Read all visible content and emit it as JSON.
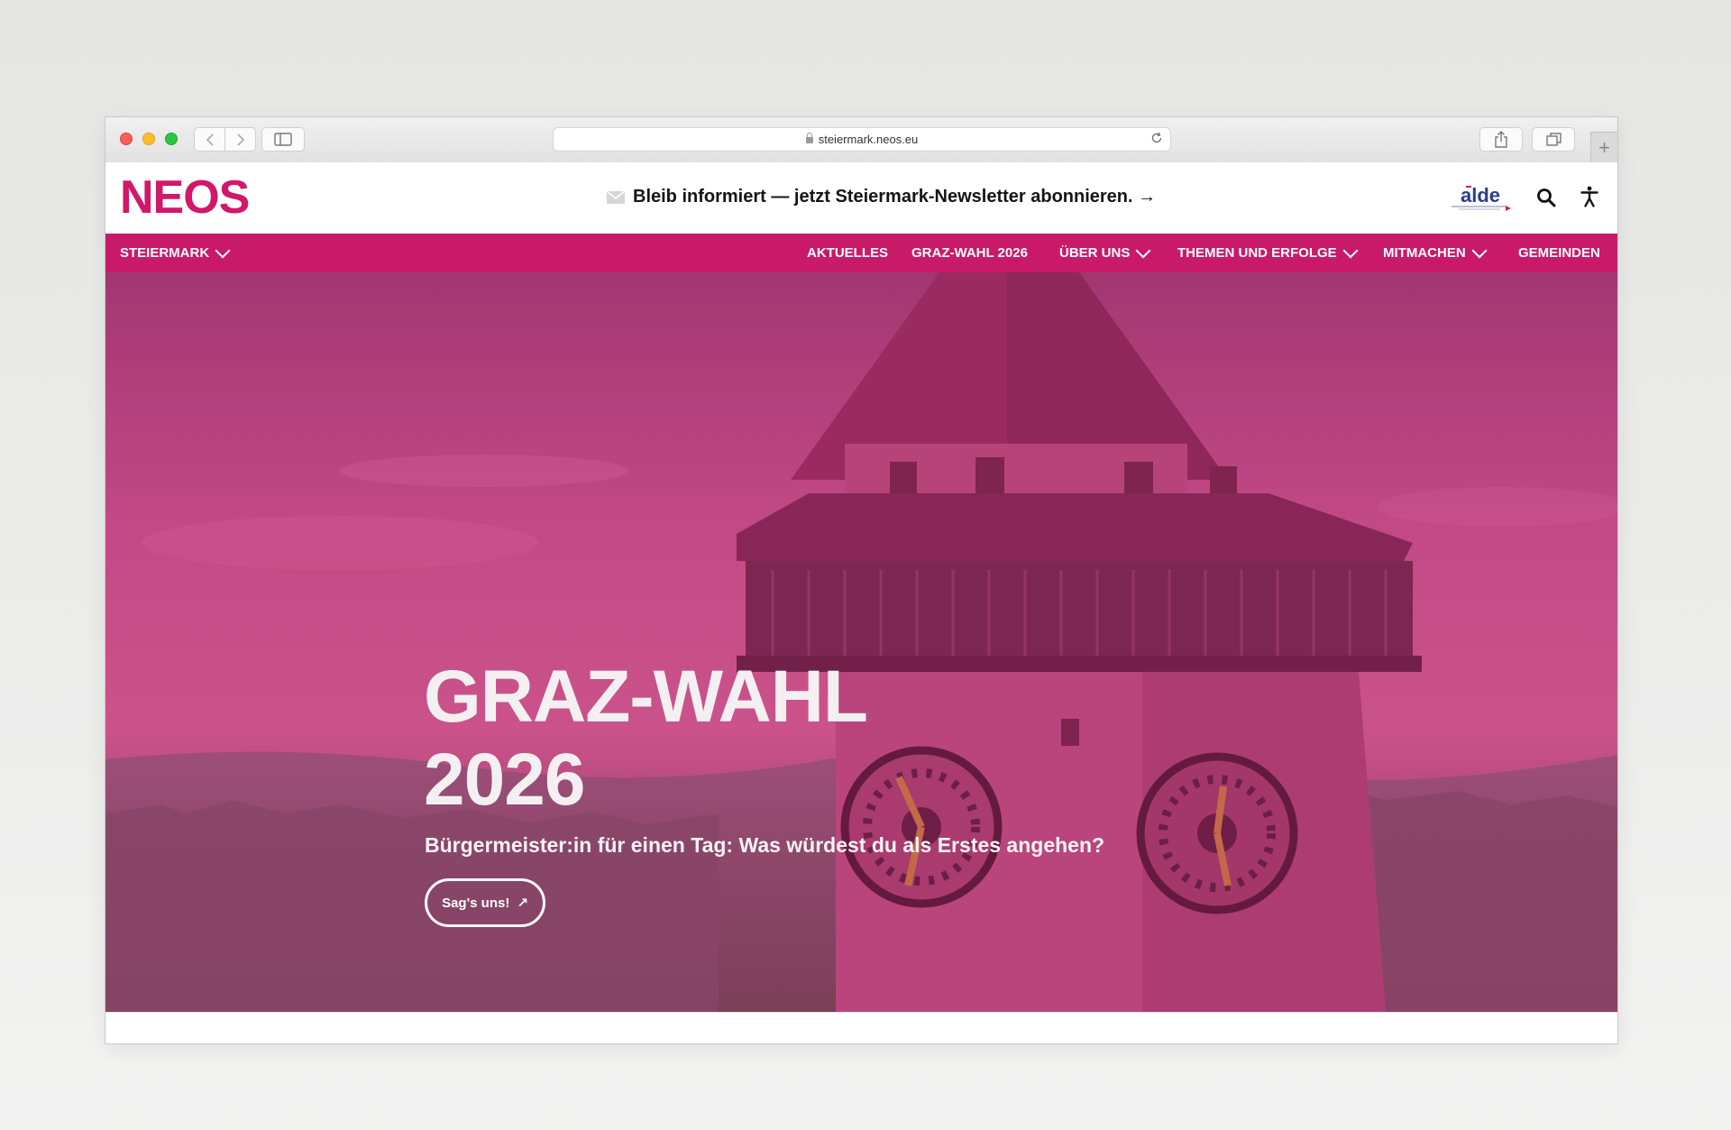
{
  "browser": {
    "url": "steiermark.neos.eu",
    "new_tab_label": "+"
  },
  "header": {
    "logo": "NEOS",
    "newsletter_text": "Bleib informiert — jetzt Steiermark-Newsletter abonnieren. →",
    "partner_logo": "alde"
  },
  "nav": {
    "region": "STEIERMARK",
    "items": [
      {
        "label": "AKTUELLES"
      },
      {
        "label": "GRAZ-WAHL 2026"
      },
      {
        "label": "ÜBER UNS"
      },
      {
        "label": "THEMEN UND ERFOLGE"
      },
      {
        "label": "MITMACHEN"
      },
      {
        "label": "GEMEINDEN"
      }
    ]
  },
  "hero": {
    "title_line1": "GRAZ-WAHL",
    "title_line2": "2026",
    "subtitle": "Bürgermeister:in für einen Tag: Was würdest du als Erstes angehen?",
    "cta_label": "Sag's uns!",
    "cta_arrow": "↗"
  },
  "colors": {
    "brand_pink": "#c91a6a",
    "logo_pink": "#d1186a"
  },
  "icons": [
    "envelope-icon",
    "search-icon",
    "accessibility-icon",
    "chevron-down-icon",
    "lock-icon",
    "reload-icon",
    "share-icon",
    "tabs-icon",
    "sidebar-icon"
  ]
}
